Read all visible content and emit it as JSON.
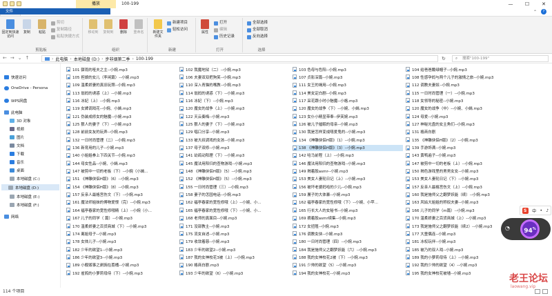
{
  "titlebar": {
    "context_tab": "播放",
    "window_title": "100-199",
    "controls": [
      "—",
      "☐",
      "✕"
    ]
  },
  "ribbon_tabs": {
    "file": "文件",
    "home": "主页",
    "share": "共享",
    "view": "查看",
    "music_tools": "音乐工具"
  },
  "ribbon": {
    "pin_label": "固定到快速访问",
    "copy_label": "复制",
    "paste_label": "粘贴",
    "cut": "剪切",
    "copy_path": "复制路径",
    "paste_shortcut": "粘贴快捷方式",
    "clipboard_group": "剪贴板",
    "move_to": "移动到",
    "copy_to": "复制到",
    "delete": "删除",
    "rename": "重命名",
    "organize_group": "组织",
    "new_folder": "新建文件夹",
    "new_item": "新建项目",
    "easy_access": "轻松访问",
    "new_group": "新建",
    "properties": "属性",
    "open": "打开",
    "edit": "编辑",
    "history": "历史记录",
    "open_group": "打开",
    "select_all": "全部选择",
    "select_none": "全部取消",
    "invert_selection": "反向选择",
    "select_group": "选择"
  },
  "address": {
    "segments": [
      "此电脑",
      "本地磁盘 (D:)",
      "步非烟第二季",
      "100-199"
    ],
    "search_placeholder": "搜索\"100-199\""
  },
  "nav": {
    "quick_access": "快速访问",
    "onedrive": "OneDrive - Persona",
    "wps": "WPS网盘",
    "this_pc": "此电脑",
    "objects3d": "3D 对象",
    "videos": "视频",
    "pictures": "图片",
    "documents": "文档",
    "downloads": "下载",
    "music": "音乐",
    "desktop": "桌面",
    "disk_c": "本地磁盘 (C:)",
    "disk_d": "本地磁盘 (D:)",
    "disk_e": "本地磁盘 (E:)",
    "disk_f": "本地磁盘 (F:)",
    "network": "网络"
  },
  "files": {
    "col1": [
      "101 骤雨的哑夫之主--小婉.mp3",
      "105 担娘的女儿（李闲篇）--小婉.mp3",
      "109 温柔娇妻的真旧玩照--小婉.mp3",
      "113 翁妈的诱惑（上）--小婉.mp3",
      "116 冰妃（上）--小婉.mp3",
      "119 女婢调戏花--小婉、小嫣.mp3",
      "121 伪装成修女的魅魔--小婉.mp3",
      "125 狠人的妻子（下）--小婉.mp3",
      "128 前前女友的玩弄--小婉.mp3",
      "132 一日时尚管理（二）--小婉.mp3",
      "136 新育用的儿子--小婉.mp3",
      "140 小姐姐拳上下四关节--小婉.mp3",
      "144 母女性品--小婉、小嫣.mp3",
      "147 被剪中一切的老板（下）--小婉（小嫣...",
      "151 《神雕侠侣H版》（6）--小婉.mp3",
      "154 《神雕侠侣H版》（8）--小婉.mp3",
      "157 反亲人最格宫伤文（下）--小婉.mp3",
      "161 魔法师姐妹的傅物爱恨（完）--小婉.mp3",
      "164 福亭春家的宽性修哦精（上）--小婉（小...",
      "167 儿子的同学（ 篇）--小婉.mp3",
      "170 温柔娇妻之百货商城（下）--小婉.mp3",
      "174 离姐母子--小婉.mp3",
      "178 女体儿子--小婉.mp3",
      "182 少年的欲望1--小婉.mp3",
      "186 少年的欲望3--小婉.mp3",
      "189 小舰贩事之剥豌在荔桶--小婉.mp3",
      "192 雀鸦的小萝莉母侍（下）--小婉.mp3"
    ],
    "col2": [
      "102 我魔地狱（二）--小婉.mp3",
      "106 夫妻双双把狗笑--小婉.mp3",
      "110 深入青猫的嘴教--小婉.mp3",
      "114 翁妈的诱惑（下）--小婉.mp3",
      "116 冰妃（下）--小婉.mp3",
      "120 魔女的战争（上）--小婉.mp3",
      "122 天云奏梅--小婉.mp3",
      "125 狠人的妻子（下）--小婉.mp3",
      "129 唱口分享--小婉.mp3",
      "133 被大叔调戏的女孩--小婉.mp3",
      "137 母子双修--小婉.mp3",
      "141 幼鸽动阳理（下）--小婉.mp3",
      "145 魔法用阳归的查物游戏--小婉.mp3",
      "148 《神雕侠侣H版》（5）--小婉.mp3",
      "152 《神雕侠侣H版》（5）--小婉.mp3",
      "155 一日时尚管理（三）--小婉.mp3",
      "158 妻子的怎园电话--小婉.mp3",
      "162 福亭春家的宽性修哦（上）--小婉、小...",
      "165 福亭春家的宽性修哦（下）--小婉、小...",
      "168 老师的真面目--小婉.mp3",
      "171 没部教主--小婉.mp3",
      "175 流女自述--小婉.mp3",
      "179 收敛着慈--小婉.mp3",
      "183 少年的欲望2--小婉.mp3",
      "187 我的女神校花3被（上）--小婉.mp3",
      "190 格商白剧.mp3",
      "193 少年的欲望（6）--小婉.mp3"
    ],
    "col3": [
      "103 色母与色阳--小婉.mp3",
      "107 贞影深篇--小婉.mp3",
      "111 女王的竭用--小婉.mp3",
      "114 美女定白剧--小婉.mp3",
      "117 采花跟小时小魅魔--小格.mp3",
      "120 魔女的战争（下）--小婉、小嫣.mp3",
      "123 女仆小精显带奉--伊芙婉.mp3",
      "126 被儿子催眠的母亲--小婉.mp3",
      "130 我是怎样变成嘻爱鬼的--小婉.mp3",
      "134 《神雕侠侣H版》（1）--小婉.mp3",
      "138 《神雕侠侣H版》（3）--小婉.mp3",
      "142 哈马前程（上）--小婉.mp3",
      "146 魔法用阳归的查物游戏--小婉.mp3",
      "149 揭着胶asmr--小婉.mp3",
      "153 美女人妻轮日记（上）--小婉.mp3",
      "156 被坏老婆妈哈的少儿--小婉.mp3",
      "159 屡子的大体暴--小婉.mp3",
      "162 福亭春家的宽性修哦（下）--小婉、小苹...",
      "165 行长大人的女秘书--小婉.mp3",
      "169 摘着胶asmr续集--小婉.mp3",
      "172 女扭殖--小婉.mp3",
      "176 调教女侠--小婉.mp3",
      "180 一日时尚管理（四）--小婉.mp3",
      "184 我是施师父之翻梦妖能（六）--小婉.mp3",
      "188 我的女神校花2被（下）--小婉.mp3",
      "191 少帅的欲望（5）--小婉.mp3",
      "194 我的女神校花--小婉.mp3"
    ],
    "col4": [
      "104 给爸爸戴绿帽子--小婉.mp3",
      "108 性感孕妈与两个儿子的激情之旅--小婉.mp3",
      "112 调教夫妻奴--小婉.mp3",
      "115 一日时尚管理（一）--小婉.mp3",
      "118 女领导的秘密--小婉.mp3",
      "120 魔女的战争（中）--小婉、小嫣.mp3",
      "124 母爱--小婉.mp3",
      "127 神秘光盘的女主角们--小婉.mp3",
      "131 格商白剧",
      "135 《神雕侠侣H版》（2）--小婉.mp3",
      "139 手游饰满--小婉.mp3",
      "143 黄鸭遍子--小婉.mp3",
      "147 被剪中一切的老板（上）--小婉.mp3",
      "150 揭色游戏里的男男女女--小婉.mp3",
      "153 美女人妻轮日记（下）--小婉.mp3",
      "157 反亲人最格宫伤文（上）--小婉.mp3",
      "160 我是施师父之翻梦妖能（续）--小婉.mp3",
      "163 风姑大姐姐的称奴夫妻--小婉.mp3",
      "166 儿子的同学（m篇）--小婉.mp3",
      "170 温柔娇妻之百货商城（上）--小婉.mp3",
      "173 我是施师父之翻梦妖能（续2）--小婉.mp3",
      "177 大童偶连--小婉.mp3",
      "181 冰权玩伴--小婉.mp3",
      "185 被乃的双人戏--小婉.mp3",
      "189 我的小萝莉母侍（上）--小婉.mp3",
      "192 我的少帅的欲望（4）--小婉.mp3",
      "195 我的女神校花被墙--小婉.mp3"
    ],
    "selected": "138 《神雕侠侣H版》（3）--小婉.mp3"
  },
  "status": {
    "item_count": "114 个项目"
  },
  "overlay": {
    "ime_label": "中",
    "gauge_value": "94",
    "gauge_unit": "%",
    "watermark": "老王论坛",
    "watermark_url": "laowang.vip"
  }
}
